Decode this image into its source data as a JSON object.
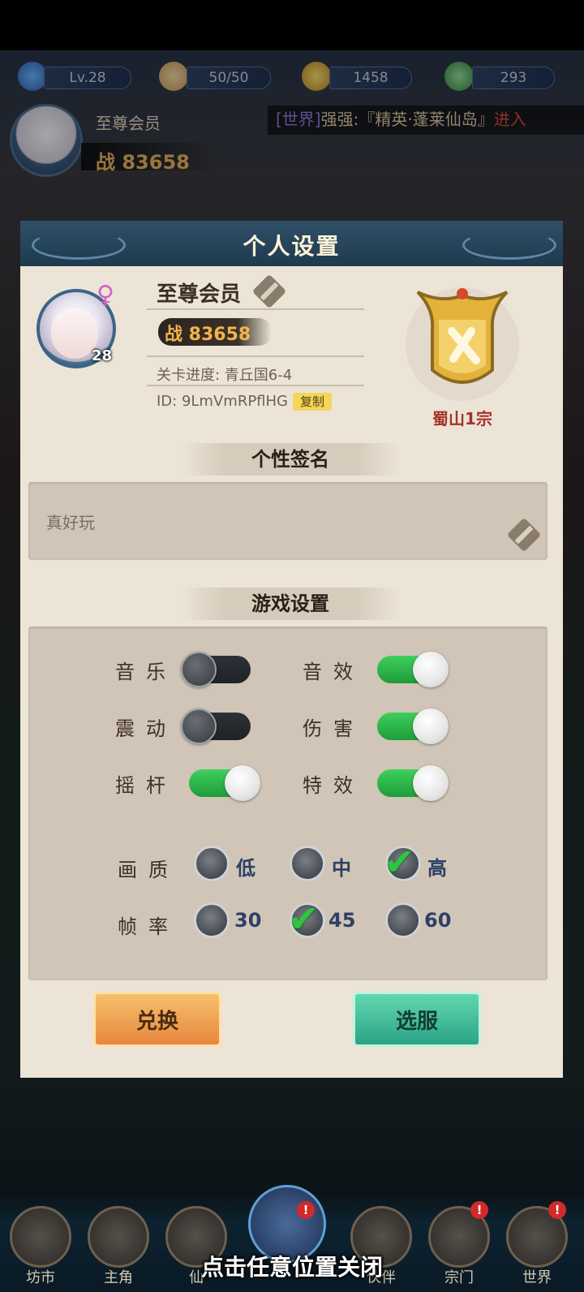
{
  "hud": {
    "level": "Lv.28",
    "stamina": "50/50",
    "coins": "1458",
    "jade": "293"
  },
  "player_strip": {
    "rank": "至尊会员",
    "power": "战 83658",
    "marquee_channel": "[世界]",
    "marquee_text": "强强:『精英·蓬莱仙岛』",
    "marquee_link": "进入"
  },
  "modal": {
    "title": "个人设置",
    "gender_symbol": "♀",
    "level": "28",
    "name": "至尊会员",
    "power": "战 83658",
    "stage": "关卡进度: 青丘国6-4",
    "id": "ID: 9LmVmRPflHG",
    "copy_label": "复制",
    "guild": "蜀山1宗",
    "signature_title": "个性签名",
    "signature": "真好玩",
    "settings_title": "游戏设置",
    "toggles": [
      {
        "label": "音乐",
        "on": false
      },
      {
        "label": "音效",
        "on": true
      },
      {
        "label": "震动",
        "on": false
      },
      {
        "label": "伤害",
        "on": true
      },
      {
        "label": "摇杆",
        "on": true
      },
      {
        "label": "特效",
        "on": true
      }
    ],
    "quality": {
      "label": "画质",
      "options": [
        "低",
        "中",
        "高"
      ],
      "selected": "高"
    },
    "framerate": {
      "label": "帧率",
      "options": [
        "30",
        "45",
        "60"
      ],
      "selected": "45"
    },
    "redeem_label": "兑换",
    "server_label": "选服"
  },
  "nav": {
    "items": [
      "坊市",
      "主角",
      "仙",
      "",
      "伙伴",
      "宗门",
      "世界"
    ]
  },
  "close_hint": "点击任意位置关闭",
  "colors": {
    "modal_bg": "#ece4d6",
    "toggle_on": "#2fc441",
    "guild_red": "#a3322a"
  }
}
